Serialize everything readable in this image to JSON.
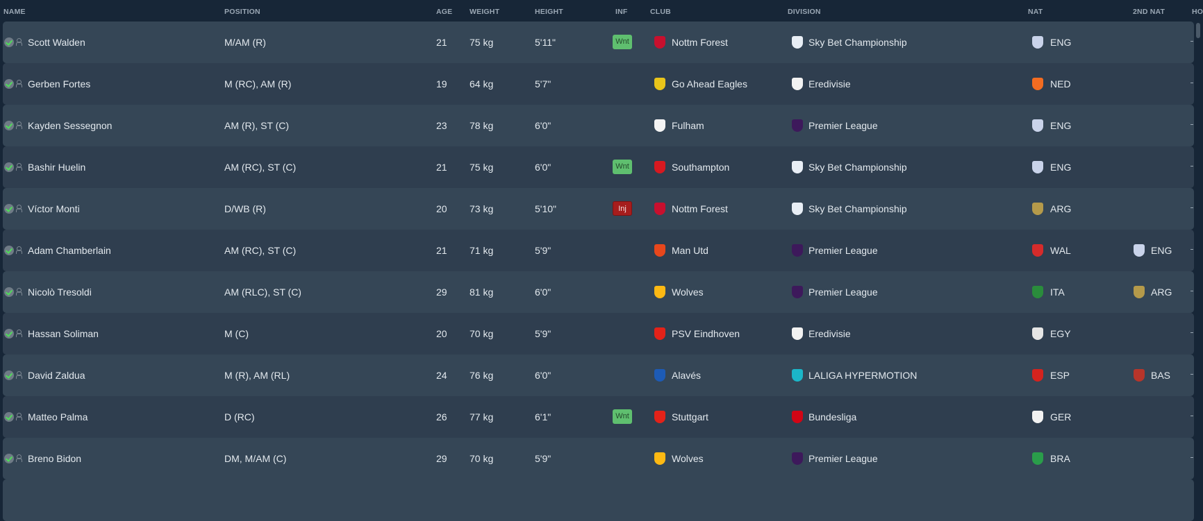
{
  "headers": {
    "name": "NAME",
    "position": "POSITION",
    "age": "AGE",
    "weight": "WEIGHT",
    "height": "HEIGHT",
    "inf": "INF",
    "club": "CLUB",
    "division": "DIVISION",
    "nat": "NAT",
    "nat2": "2ND NAT",
    "ho": "HO"
  },
  "colors": {
    "background": "#172637",
    "row_light": "#354656",
    "row_dark": "#2f3e4f",
    "wnt": "#5fbf6f",
    "inj": "#a61d1d"
  },
  "players": [
    {
      "name": "Scott Walden",
      "position": "M/AM (R)",
      "age": "21",
      "weight": "75 kg",
      "height": "5'11\"",
      "inf": "Wnt",
      "club": "Nottm Forest",
      "club_icon": "nottm-forest-crest",
      "club_color": "#c8102e",
      "division": "Sky Bet Championship",
      "division_icon": "efl-championship-logo",
      "division_color": "#e8eef5",
      "nat": "ENG",
      "nat_icon": "england-crest",
      "nat_color": "#c9d3ea",
      "nat2": "",
      "nat2_icon": "",
      "nat2_color": ""
    },
    {
      "name": "Gerben Fortes",
      "position": "M (RC), AM (R)",
      "age": "19",
      "weight": "64 kg",
      "height": "5'7\"",
      "inf": "",
      "club": "Go Ahead Eagles",
      "club_icon": "go-ahead-eagles-crest",
      "club_color": "#e9c41a",
      "division": "Eredivisie",
      "division_icon": "eredivisie-logo",
      "division_color": "#f2f2f2",
      "nat": "NED",
      "nat_icon": "netherlands-crest",
      "nat_color": "#f36c21",
      "nat2": "",
      "nat2_icon": "",
      "nat2_color": ""
    },
    {
      "name": "Kayden Sessegnon",
      "position": "AM (R), ST (C)",
      "age": "23",
      "weight": "78 kg",
      "height": "6'0\"",
      "inf": "",
      "club": "Fulham",
      "club_icon": "fulham-crest",
      "club_color": "#f4f4f4",
      "division": "Premier League",
      "division_icon": "premier-league-logo",
      "division_color": "#3d195b",
      "nat": "ENG",
      "nat_icon": "england-crest",
      "nat_color": "#c9d3ea",
      "nat2": "",
      "nat2_icon": "",
      "nat2_color": ""
    },
    {
      "name": "Bashir Huelin",
      "position": "AM (RC), ST (C)",
      "age": "21",
      "weight": "75 kg",
      "height": "6'0\"",
      "inf": "Wnt",
      "club": "Southampton",
      "club_icon": "southampton-crest",
      "club_color": "#d71920",
      "division": "Sky Bet Championship",
      "division_icon": "efl-championship-logo",
      "division_color": "#e8eef5",
      "nat": "ENG",
      "nat_icon": "england-crest",
      "nat_color": "#c9d3ea",
      "nat2": "",
      "nat2_icon": "",
      "nat2_color": ""
    },
    {
      "name": "Víctor Monti",
      "position": "D/WB (R)",
      "age": "20",
      "weight": "73 kg",
      "height": "5'10\"",
      "inf": "Inj",
      "club": "Nottm Forest",
      "club_icon": "nottm-forest-crest",
      "club_color": "#c8102e",
      "division": "Sky Bet Championship",
      "division_icon": "efl-championship-logo",
      "division_color": "#e8eef5",
      "nat": "ARG",
      "nat_icon": "argentina-crest",
      "nat_color": "#b59a4a",
      "nat2": "",
      "nat2_icon": "",
      "nat2_color": ""
    },
    {
      "name": "Adam Chamberlain",
      "position": "AM (RC), ST (C)",
      "age": "21",
      "weight": "71 kg",
      "height": "5'9\"",
      "inf": "",
      "club": "Man Utd",
      "club_icon": "man-utd-crest",
      "club_color": "#e8471c",
      "division": "Premier League",
      "division_icon": "premier-league-logo",
      "division_color": "#3d195b",
      "nat": "WAL",
      "nat_icon": "wales-crest",
      "nat_color": "#d62b2b",
      "nat2": "ENG",
      "nat2_icon": "england-crest",
      "nat2_color": "#c9d3ea"
    },
    {
      "name": "Nicolò Tresoldi",
      "position": "AM (RLC), ST (C)",
      "age": "29",
      "weight": "81 kg",
      "height": "6'0\"",
      "inf": "",
      "club": "Wolves",
      "club_icon": "wolves-crest",
      "club_color": "#fdb913",
      "division": "Premier League",
      "division_icon": "premier-league-logo",
      "division_color": "#3d195b",
      "nat": "ITA",
      "nat_icon": "italy-crest",
      "nat_color": "#2a8c3c",
      "nat2": "ARG",
      "nat2_icon": "argentina-crest",
      "nat2_color": "#b59a4a"
    },
    {
      "name": "Hassan Soliman",
      "position": "M (C)",
      "age": "20",
      "weight": "70 kg",
      "height": "5'9\"",
      "inf": "",
      "club": "PSV Eindhoven",
      "club_icon": "psv-crest",
      "club_color": "#e32219",
      "division": "Eredivisie",
      "division_icon": "eredivisie-logo",
      "division_color": "#f2f2f2",
      "nat": "EGY",
      "nat_icon": "egypt-crest",
      "nat_color": "#e5e5e5",
      "nat2": "",
      "nat2_icon": "",
      "nat2_color": ""
    },
    {
      "name": "David Zaldua",
      "position": "M (R), AM (RL)",
      "age": "24",
      "weight": "76 kg",
      "height": "6'0\"",
      "inf": "",
      "club": "Alavés",
      "club_icon": "alaves-crest",
      "club_color": "#1d5bb6",
      "division": "LALIGA HYPERMOTION",
      "division_icon": "laliga-hypermotion-logo",
      "division_color": "#1bb6c8",
      "nat": "ESP",
      "nat_icon": "spain-crest",
      "nat_color": "#d4231e",
      "nat2": "BAS",
      "nat2_icon": "basque-crest",
      "nat2_color": "#b8352a"
    },
    {
      "name": "Matteo Palma",
      "position": "D (RC)",
      "age": "26",
      "weight": "77 kg",
      "height": "6'1\"",
      "inf": "Wnt",
      "club": "Stuttgart",
      "club_icon": "stuttgart-crest",
      "club_color": "#e32219",
      "division": "Bundesliga",
      "division_icon": "bundesliga-logo",
      "division_color": "#d20515",
      "nat": "GER",
      "nat_icon": "germany-crest",
      "nat_color": "#f2f2f2",
      "nat2": "",
      "nat2_icon": "",
      "nat2_color": ""
    },
    {
      "name": "Breno Bidon",
      "position": "DM, M/AM (C)",
      "age": "29",
      "weight": "70 kg",
      "height": "5'9\"",
      "inf": "",
      "club": "Wolves",
      "club_icon": "wolves-crest",
      "club_color": "#fdb913",
      "division": "Premier League",
      "division_icon": "premier-league-logo",
      "division_color": "#3d195b",
      "nat": "BRA",
      "nat_icon": "brazil-crest",
      "nat_color": "#2a9d4a",
      "nat2": "",
      "nat2_icon": "",
      "nat2_color": ""
    }
  ]
}
